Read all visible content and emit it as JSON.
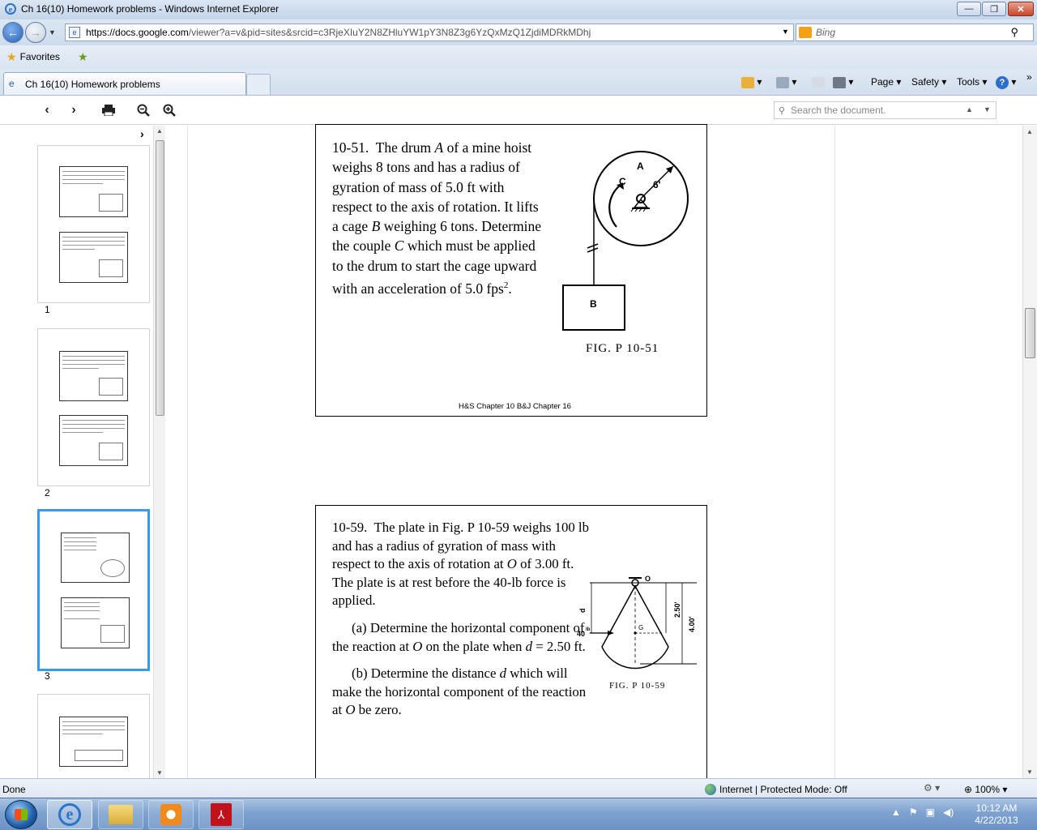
{
  "window": {
    "title": "Ch 16(10) Homework problems - Windows Internet Explorer",
    "min_label": "—",
    "max_label": "❐",
    "close_label": "✕"
  },
  "address": {
    "url_host": "https://docs.google.com",
    "url_path": "/viewer?a=v&pid=sites&srcid=c3RjeXIuY2N8ZHluYW1pY3N8Z3g6YzQxMzQ1ZjdiMDRkMDhj",
    "search_placeholder": "Bing"
  },
  "favorites": {
    "label": "Favorites"
  },
  "tab": {
    "label": "Ch 16(10) Homework problems"
  },
  "command_bar": {
    "page": "Page ▾",
    "safety": "Safety ▾",
    "tools": "Tools ▾",
    "help": "?"
  },
  "viewer": {
    "search_placeholder": "Search the document."
  },
  "thumbnails": {
    "pages": [
      "1",
      "2",
      "3"
    ],
    "selected": "3"
  },
  "page1": {
    "problem_number": "10-51.",
    "text_parts": [
      "The drum ",
      "A",
      " of a mine hoist weighs 8 tons and has a radius of gyration of mass of 5.0 ft with respect to the axis of rotation.  It lifts a cage ",
      "B",
      " weighing 6 tons.  Determine the couple ",
      "C",
      " which must be applied to the drum to start the cage upward with an acceleration of 5.0 fps",
      "2",
      "."
    ],
    "figure_caption": "FIG. P 10-51",
    "figure_labels": {
      "drum": "A",
      "couple": "C",
      "radius": "6'",
      "cage": "B"
    },
    "footer": "H&S Chapter 10  B&J Chapter 16"
  },
  "page2": {
    "problem_number": "10-59.",
    "intro": "The plate in Fig. P 10-59 weighs 100 lb and has a radius of gyration of mass with respect to the axis of rotation at ",
    "O": "O",
    "intro2": " of 3.00 ft.  The plate is at rest before the 40-lb force is applied.",
    "part_a_1": "(a) Determine the horizontal component of the reaction at ",
    "part_a_2": " on the plate when ",
    "d": "d",
    "part_a_3": " = 2.50 ft.",
    "part_b_1": "(b) Determine the distance ",
    "part_b_2": " which will make the horizontal component of the reaction at ",
    "part_b_3": " be zero.",
    "figure_caption": "FIG. P 10-59",
    "figure_labels": {
      "pivot": "O",
      "d": "d",
      "force": "40",
      "force_unit": "lb",
      "centroid": "G",
      "dim1": "2.50'",
      "dim2": "4.00'"
    }
  },
  "status": {
    "text": "Done",
    "zone": "Internet | Protected Mode: Off",
    "zoom": "100%"
  },
  "clock": {
    "time": "10:12 AM",
    "date": "4/22/2013"
  }
}
